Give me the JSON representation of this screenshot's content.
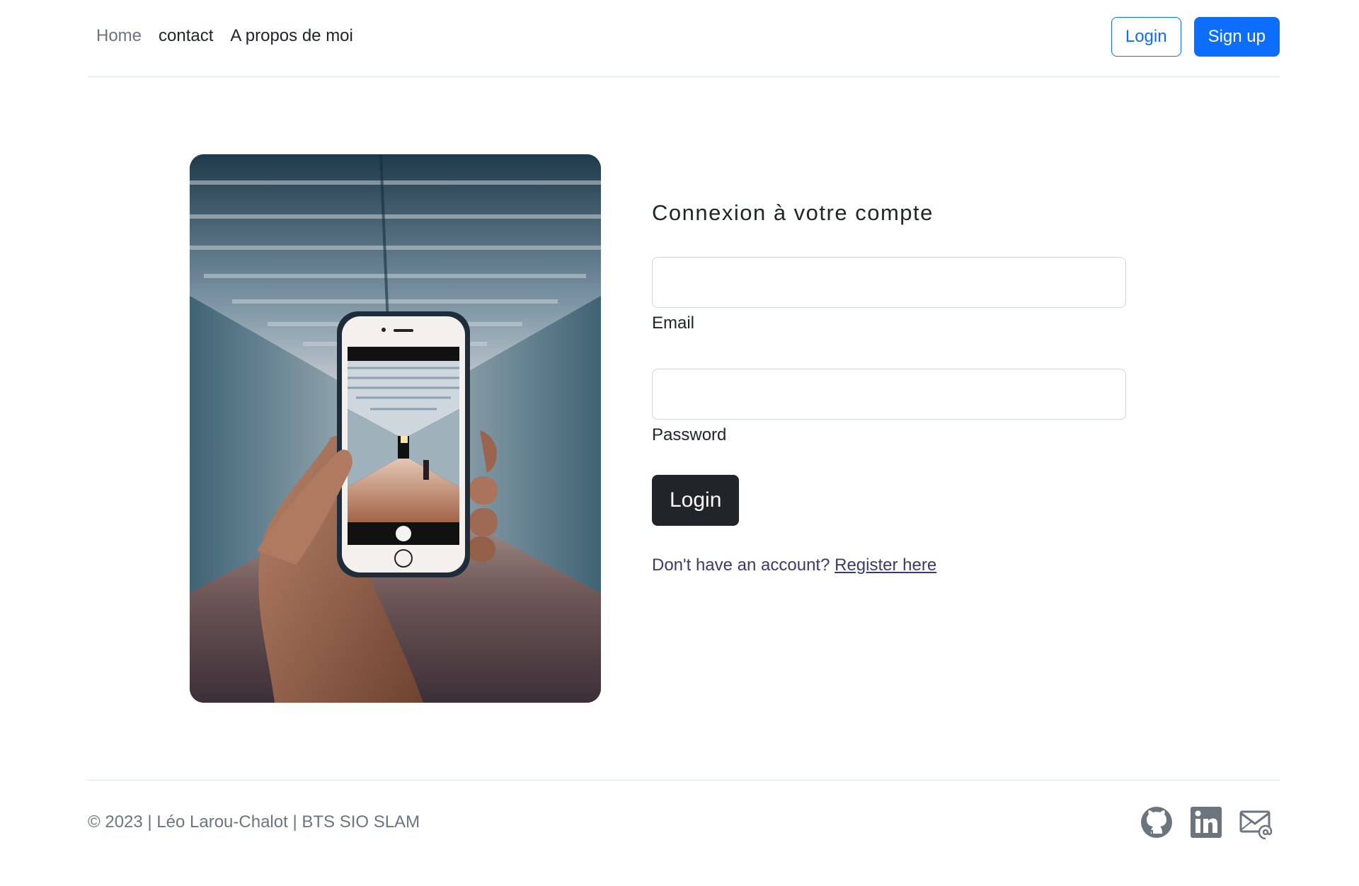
{
  "nav": {
    "links": [
      {
        "label": "Home"
      },
      {
        "label": "contact"
      },
      {
        "label": "A propos de moi"
      }
    ],
    "login_label": "Login",
    "signup_label": "Sign up"
  },
  "hero": {
    "image_alt": "hand-holding-phone-photo"
  },
  "login_form": {
    "title": "Connexion à votre compte",
    "email_label": "Email",
    "email_value": "",
    "password_label": "Password",
    "password_value": "",
    "submit_label": "Login",
    "register_prompt": "Don't have an account?",
    "register_link": "Register here"
  },
  "footer": {
    "copyright": "© 2023 | Léo Larou-Chalot | BTS SIO SLAM",
    "socials": [
      {
        "icon": "github-icon"
      },
      {
        "icon": "linkedin-icon"
      },
      {
        "icon": "email-icon"
      }
    ]
  },
  "colors": {
    "primary": "#0d6efd",
    "dark": "#212529",
    "muted": "#6c757d",
    "link": "#3b3b6b",
    "border": "#dee2e6"
  }
}
